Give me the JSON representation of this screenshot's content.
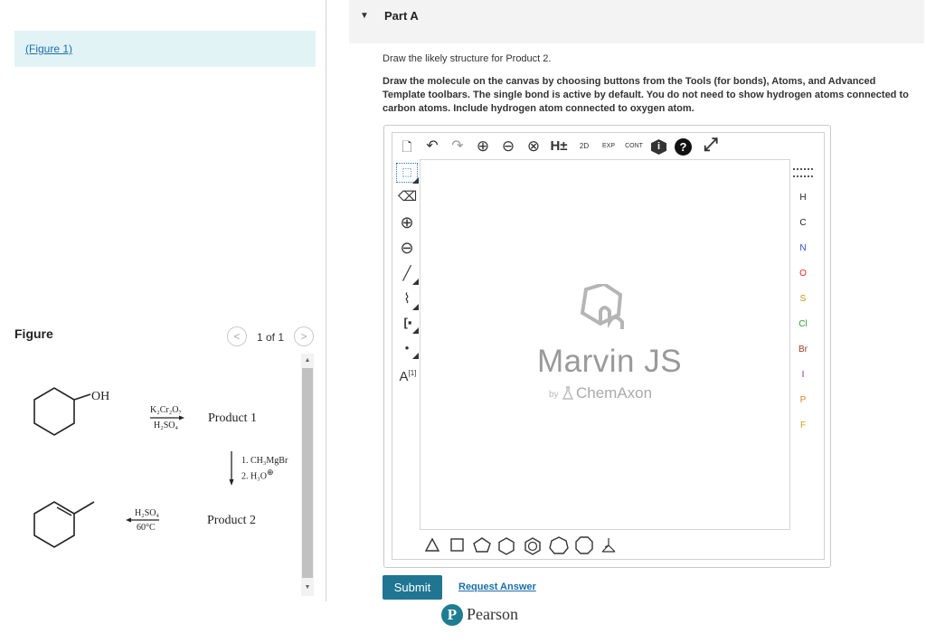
{
  "left": {
    "figure_link": "(Figure 1)",
    "figure_title": "Figure",
    "pager": {
      "text": "1 of 1",
      "prev": "<",
      "next": ">"
    },
    "figure": {
      "oh_label": "OH",
      "reagent1_top": "K₂Cr₂O₇",
      "reagent1_bottom": "H₂SO₄",
      "product1": "Product 1",
      "reagent2_line1": "1. CH₃MgBr",
      "reagent2_line2": "2. H₃O",
      "reagent2_charge": "⊕",
      "reagent3_top": "H₂SO₄",
      "reagent3_bottom": "60°C",
      "product2": "Product 2"
    },
    "scroll": {
      "up": "▲",
      "down": "▼"
    }
  },
  "part": {
    "caret": "▼",
    "title": "Part A",
    "question": "Draw the likely structure for Product 2.",
    "instructions": "Draw the molecule on the canvas by choosing buttons from the Tools (for bonds), Atoms, and Advanced Template toolbars. The single bond is active by default. You do not need to show hydrogen atoms connected to carbon atoms. Include hydrogen atom connected to oxygen atom."
  },
  "editor": {
    "toolbar_top": [
      {
        "name": "new-document-icon",
        "glyph": "🗋"
      },
      {
        "name": "undo-icon",
        "glyph": "↶"
      },
      {
        "name": "redo-icon",
        "glyph": "↷"
      },
      {
        "name": "zoom-in-icon",
        "glyph": "⊕"
      },
      {
        "name": "zoom-out-icon",
        "glyph": "⊖"
      },
      {
        "name": "zoom-fit-icon",
        "glyph": "⊗"
      },
      {
        "name": "hydrogen-toggle-icon",
        "glyph": "H±"
      },
      {
        "name": "clean-2d-icon",
        "glyph": "2D"
      },
      {
        "name": "expand-icon",
        "glyph": "EXP"
      },
      {
        "name": "contract-icon",
        "glyph": "CONT"
      },
      {
        "name": "info-icon",
        "glyph": "i"
      },
      {
        "name": "help-icon",
        "glyph": "?"
      },
      {
        "name": "fullscreen-icon",
        "glyph": "⤢"
      }
    ],
    "tools_left": [
      {
        "name": "select-icon",
        "glyph": "⬚"
      },
      {
        "name": "erase-icon",
        "glyph": "⌫"
      },
      {
        "name": "increase-charge-icon",
        "glyph": "⊕"
      },
      {
        "name": "decrease-charge-icon",
        "glyph": "⊖"
      },
      {
        "name": "single-bond-icon",
        "glyph": "╱"
      },
      {
        "name": "chain-icon",
        "glyph": "⌇"
      },
      {
        "name": "bracket-icon",
        "glyph": "[▪"
      },
      {
        "name": "radical-icon",
        "glyph": "•"
      },
      {
        "name": "atom-label-icon",
        "glyph": "A"
      }
    ],
    "atom_label_sup": "[1]",
    "atoms": [
      {
        "label": "H",
        "color": "#333333"
      },
      {
        "label": "C",
        "color": "#333333"
      },
      {
        "label": "N",
        "color": "#2b4bd8"
      },
      {
        "label": "O",
        "color": "#e0261c"
      },
      {
        "label": "S",
        "color": "#b59a12"
      },
      {
        "label": "Cl",
        "color": "#2aa02a"
      },
      {
        "label": "Br",
        "color": "#9a3a1a"
      },
      {
        "label": "I",
        "color": "#8a2aa0"
      },
      {
        "label": "P",
        "color": "#d9822b"
      },
      {
        "label": "F",
        "color": "#c9a020"
      }
    ],
    "watermark": {
      "title": "Marvin JS",
      "by": "by",
      "brand": "ChemAxon"
    }
  },
  "actions": {
    "submit": "Submit",
    "request_answer": "Request Answer"
  },
  "footer": {
    "brand_letter": "P",
    "brand": "Pearson"
  }
}
